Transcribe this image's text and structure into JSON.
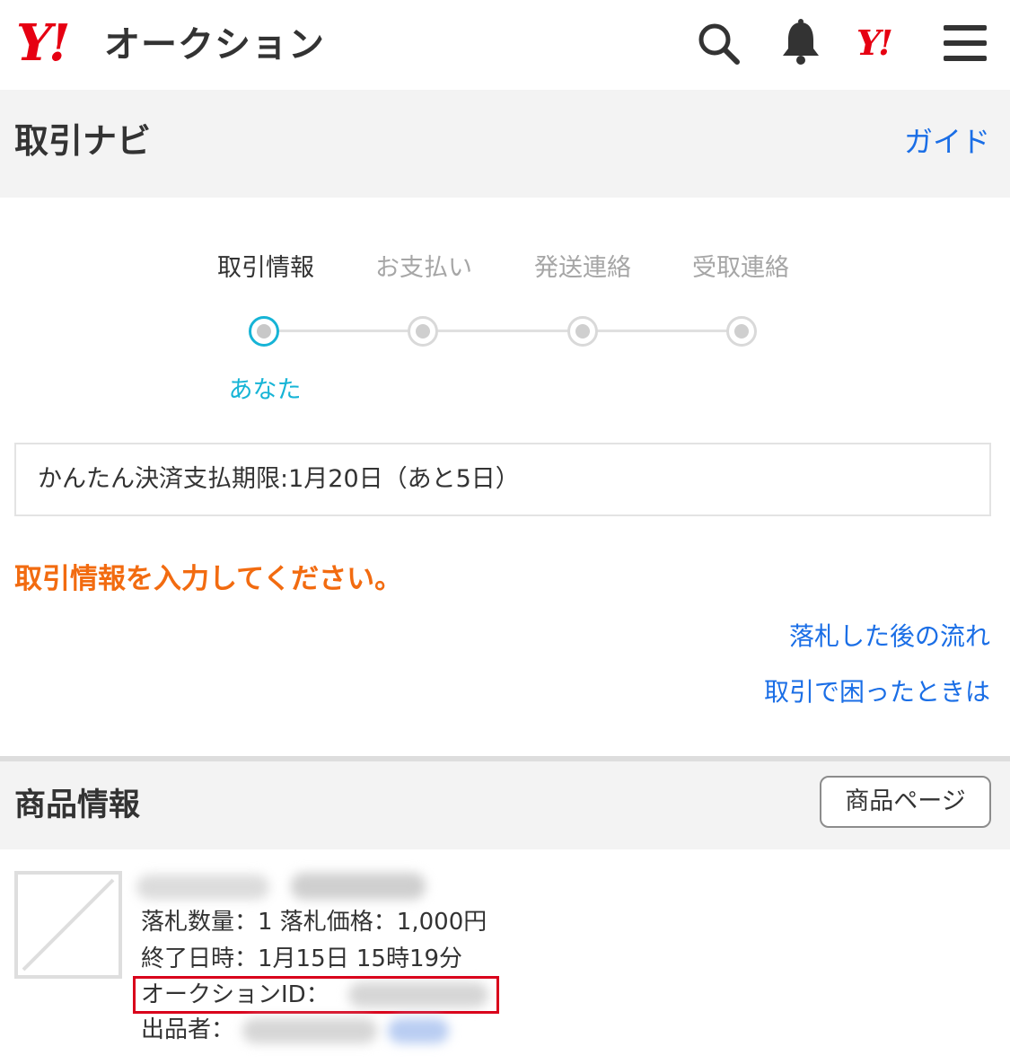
{
  "header": {
    "logo_mark": "Y!",
    "logo_text": "オークション",
    "colors": {
      "brand_red": "#e60012",
      "link_blue": "#1a6ee6",
      "accent_cyan": "#16b4d6",
      "warning_orange": "#f26b10",
      "highlight_red": "#d9001b"
    },
    "icons": [
      "search-icon",
      "bell-icon",
      "yahoo-icon",
      "menu-icon"
    ],
    "yahoo_mark": "Y!"
  },
  "title_bar": {
    "title": "取引ナビ",
    "guide_link": "ガイド"
  },
  "stepper": {
    "steps": [
      {
        "label": "取引情報",
        "active": true
      },
      {
        "label": "お支払い",
        "active": false
      },
      {
        "label": "発送連絡",
        "active": false
      },
      {
        "label": "受取連絡",
        "active": false
      }
    ],
    "current_actor": "あなた"
  },
  "notice": {
    "text": "かんたん決済支払期限:1月20日（あと5日）"
  },
  "instruction": "取引情報を入力してください。",
  "links": {
    "after_winning_flow": "落札した後の流れ",
    "trouble": "取引で困ったときは"
  },
  "product": {
    "section_title": "商品情報",
    "product_page_button": "商品ページ",
    "quantity_price": "落札数量：1 落札価格：1,000円",
    "end_time": "終了日時：1月15日 15時19分",
    "auction_id_label": "オークションID：",
    "seller_label": "出品者："
  }
}
